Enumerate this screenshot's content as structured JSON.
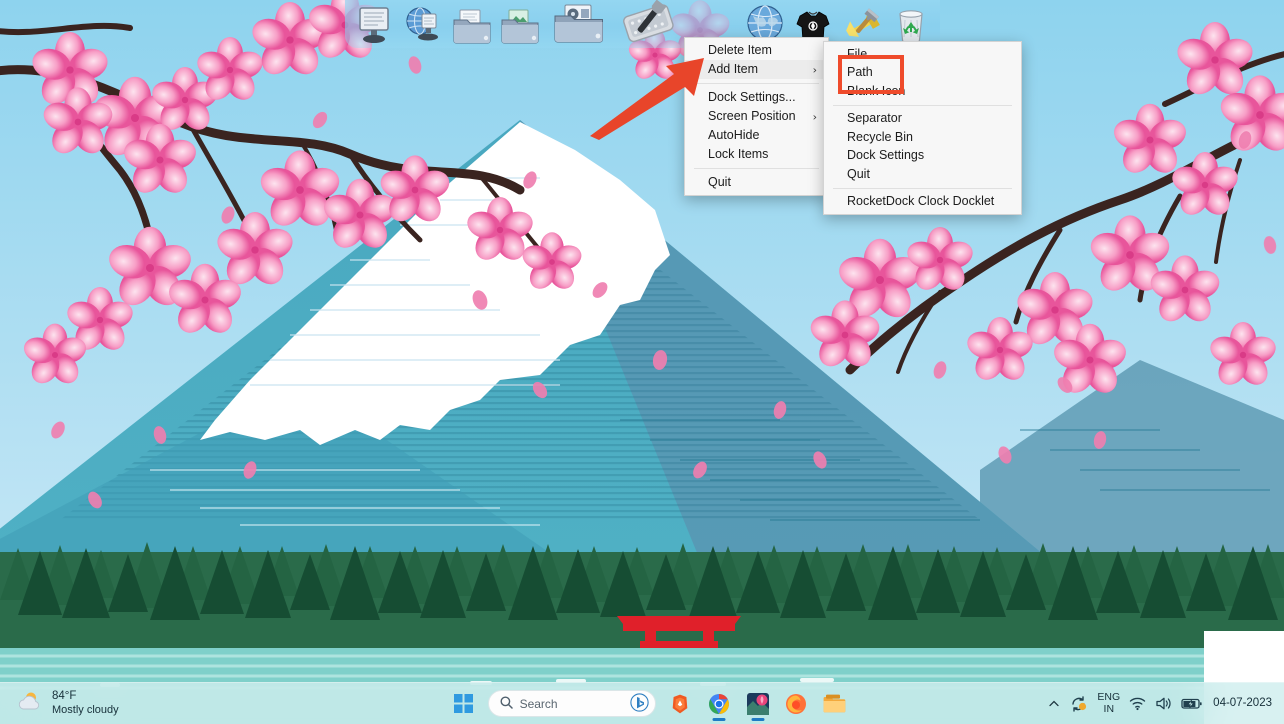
{
  "wallpaper": {
    "description": "Cherry blossom branches with Mount Fuji, forest, torii gate",
    "sky_top": "#8ed3ee",
    "sky_bottom": "#cfeaf6",
    "mountain": "#4aa9c0",
    "mountain_shadow": "#5b8fae",
    "snow": "#ffffff",
    "forest_dark": "#1b5238",
    "forest_mid": "#2d6b47",
    "water": "#7fd0ca",
    "torii": "#e0202a",
    "blossom_pink": "#f285b4",
    "blossom_light": "#f9bcd6",
    "branch": "#3a2420"
  },
  "dock": {
    "name": "RocketDock",
    "icons": [
      {
        "name": "display-settings-icon",
        "label": "Display"
      },
      {
        "name": "internet-globe-icon",
        "label": "Internet"
      },
      {
        "name": "folder-documents-icon",
        "label": "Documents"
      },
      {
        "name": "folder-pictures-icon",
        "label": "Pictures"
      },
      {
        "name": "folder-media-icon",
        "label": "Media"
      },
      {
        "name": "tools-wrench-icon",
        "label": "Tools"
      },
      {
        "name": "internet-globe-icon",
        "label": "Browser"
      },
      {
        "name": "tshirt-skins-icon",
        "label": "Skins"
      },
      {
        "name": "hammer-paint-icon",
        "label": "Customize"
      },
      {
        "name": "recycle-bin-icon",
        "label": "Recycle Bin"
      }
    ]
  },
  "context_menu": {
    "items": [
      {
        "label": "Delete Item",
        "submenu": false,
        "highlighted": false
      },
      {
        "label": "Add Item",
        "submenu": true,
        "highlighted": true
      },
      {
        "separator": true
      },
      {
        "label": "Dock Settings...",
        "submenu": false,
        "highlighted": false
      },
      {
        "label": "Screen Position",
        "submenu": true,
        "highlighted": false
      },
      {
        "label": "AutoHide",
        "submenu": false,
        "highlighted": false
      },
      {
        "label": "Lock Items",
        "submenu": false,
        "highlighted": false
      },
      {
        "separator": true
      },
      {
        "label": "Quit",
        "submenu": false,
        "highlighted": false
      }
    ],
    "submenu_arrow": "›"
  },
  "add_item_submenu": {
    "items": [
      {
        "label": "File"
      },
      {
        "label": "Path"
      },
      {
        "label": "Blank Icon"
      },
      {
        "separator": true
      },
      {
        "label": "Separator"
      },
      {
        "label": "Recycle Bin"
      },
      {
        "label": "Dock Settings"
      },
      {
        "label": "Quit"
      },
      {
        "separator": true
      },
      {
        "label": "RocketDock Clock Docklet"
      }
    ]
  },
  "annotations": {
    "highlight_color": "#ef4b2b",
    "arrow_color": "#e8452a",
    "arrow_target": "Add Item",
    "box_target": "File and Path"
  },
  "taskbar": {
    "weather": {
      "temperature": "84°F",
      "condition": "Mostly cloudy",
      "icon": "partly-cloudy-sun-icon"
    },
    "start_button": "start-button",
    "search": {
      "placeholder": "Search",
      "icon": "search-icon",
      "bing_icon": "bing-icon"
    },
    "apps": [
      {
        "name": "brave-browser-icon",
        "label": "Brave",
        "running": false
      },
      {
        "name": "google-chrome-icon",
        "label": "Google Chrome",
        "running": true
      },
      {
        "name": "photos-app-icon",
        "label": "Photos",
        "running": true
      },
      {
        "name": "firefox-browser-icon",
        "label": "Firefox",
        "running": false
      },
      {
        "name": "file-explorer-icon",
        "label": "File Explorer",
        "running": false
      }
    ],
    "tray": {
      "overflow_chevron": "˄",
      "update_icon": "windows-update-icon",
      "language": {
        "line1": "ENG",
        "line2": "IN"
      },
      "wifi_icon": "wifi-icon",
      "volume_icon": "volume-icon",
      "battery_icon": "battery-charging-icon",
      "date": "04-07-2023"
    }
  }
}
